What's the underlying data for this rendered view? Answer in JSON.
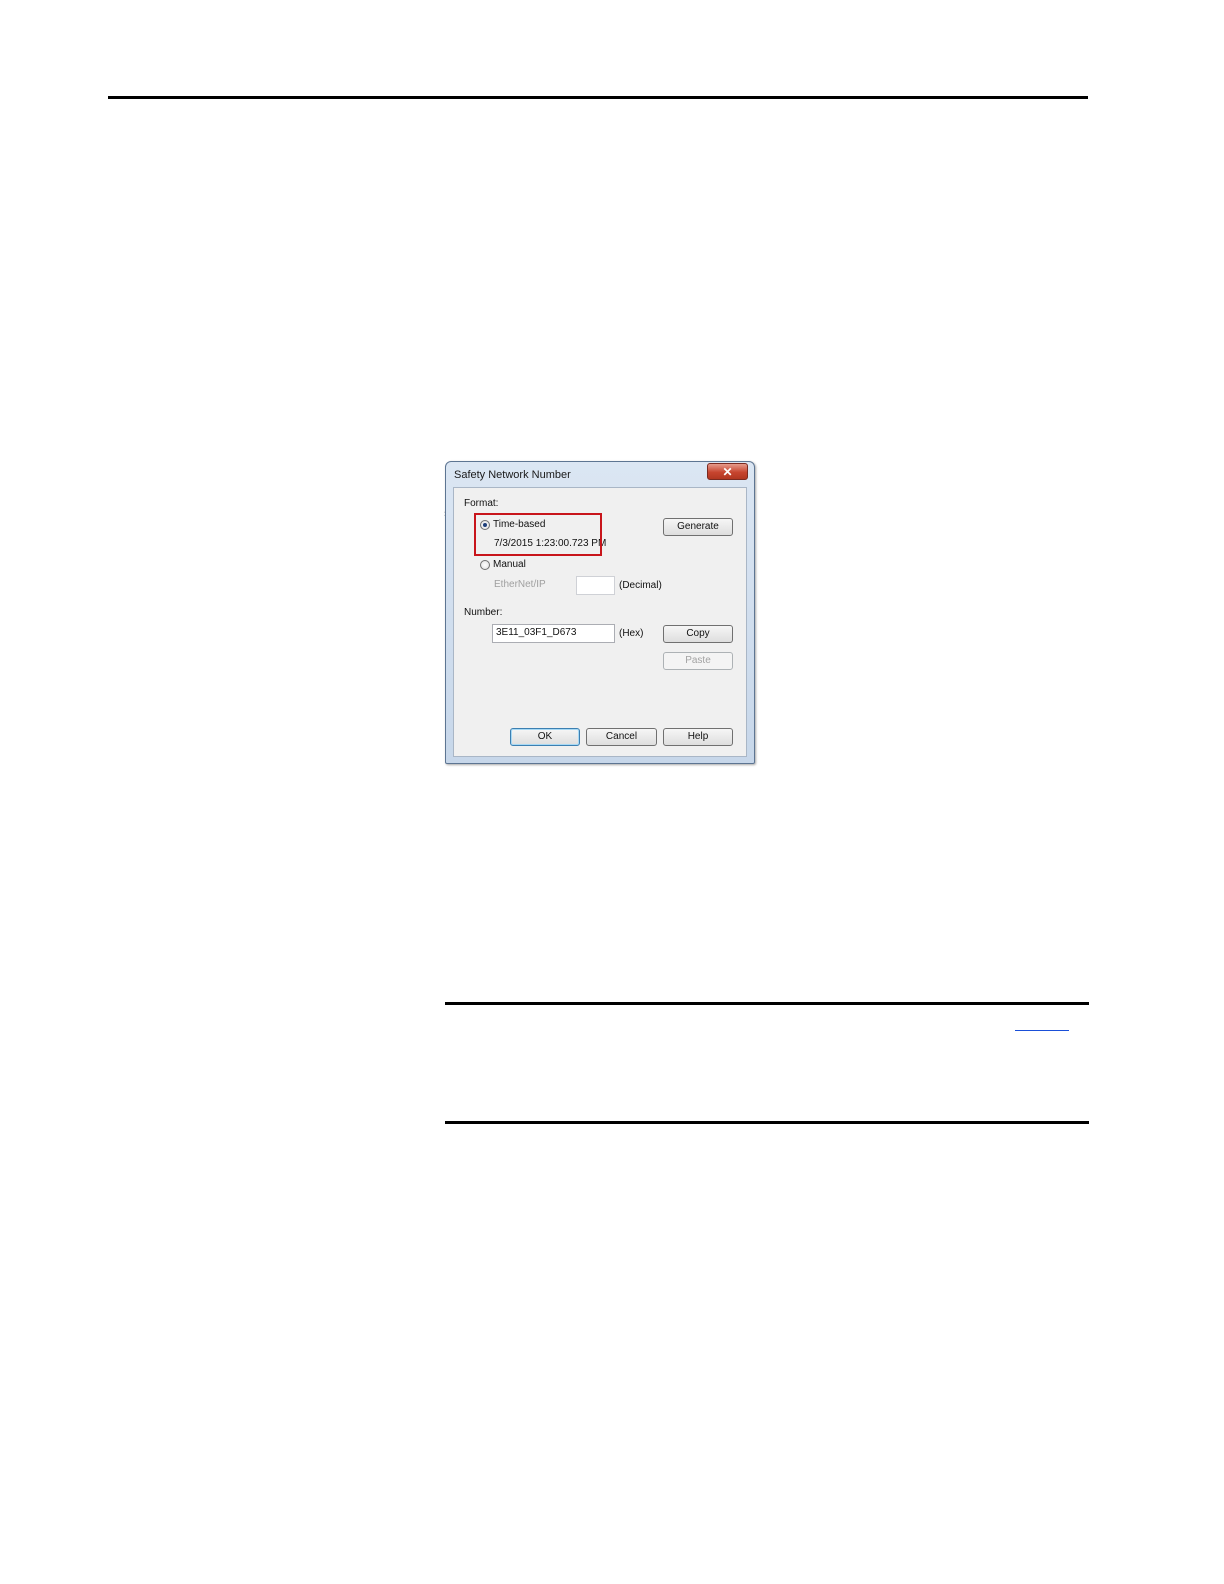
{
  "dialog": {
    "title": "Safety Network Number",
    "close_icon": "close-icon",
    "format_label": "Format:",
    "time_based": {
      "label": "Time-based",
      "selected": true,
      "value": "7/3/2015 1:23:00.723 PM"
    },
    "manual": {
      "label": "Manual",
      "selected": false,
      "ethernet_label": "EtherNet/IP",
      "ethernet_value": "",
      "unit": "(Decimal)"
    },
    "number_label": "Number:",
    "number_value": "3E11_03F1_D673",
    "number_unit": "(Hex)",
    "buttons": {
      "generate": "Generate",
      "copy": "Copy",
      "paste": "Paste",
      "ok": "OK",
      "cancel": "Cancel",
      "help": "Help"
    }
  },
  "colors": {
    "highlight": "#c8151b",
    "title_bar": "#dbe6f3",
    "close_button": "#c7452f"
  }
}
